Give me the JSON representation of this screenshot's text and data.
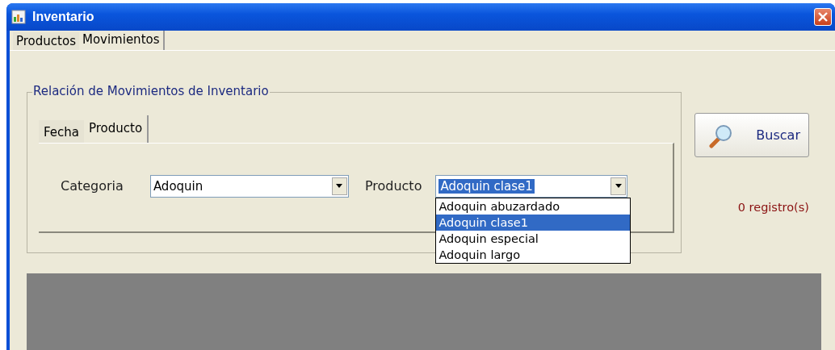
{
  "window": {
    "title": "Inventario"
  },
  "tabs": [
    {
      "label": "Productos",
      "selected": false
    },
    {
      "label": "Movimientos",
      "selected": true
    }
  ],
  "group": {
    "title": "Relación de Movimientos de Inventario",
    "tabs": [
      {
        "label": "Fecha",
        "selected": false
      },
      {
        "label": "Producto",
        "selected": true
      }
    ],
    "categoria": {
      "label": "Categoria",
      "value": "Adoquin"
    },
    "producto": {
      "label": "Producto",
      "value": "Adoquin clase1",
      "expanded": true,
      "options": [
        {
          "label": "Adoquin abuzardado",
          "selected": false
        },
        {
          "label": "Adoquin clase1",
          "selected": true
        },
        {
          "label": "Adoquin especial",
          "selected": false
        },
        {
          "label": "Adoquin largo",
          "selected": false
        }
      ]
    }
  },
  "search_button": {
    "label": "Buscar"
  },
  "record_count": "0 registro(s)"
}
